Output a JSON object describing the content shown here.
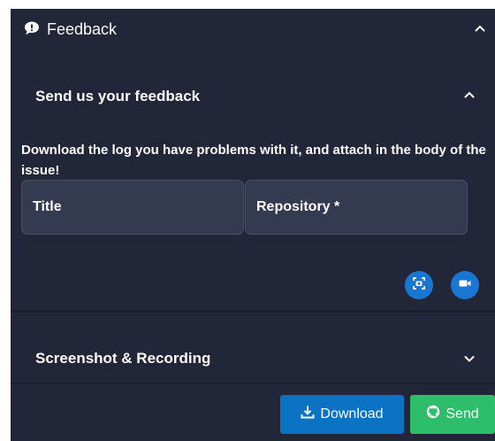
{
  "header": {
    "title": "Feedback",
    "icon": "comment-icon"
  },
  "feedback_section": {
    "title": "Send us your feedback",
    "description": "Download the log you have problems with it, and attach in the body of the issue!",
    "fields": [
      {
        "label": "Title"
      },
      {
        "label": "Repository *"
      }
    ],
    "actions": [
      "screenshot-icon",
      "video-camera-icon"
    ]
  },
  "recording_section": {
    "title": "Screenshot & Recording"
  },
  "footer": {
    "download_label": "Download",
    "send_label": "Send"
  },
  "colors": {
    "panel_bg": "#212639",
    "field_bg": "#343a50",
    "accent_blue": "#1976d2",
    "download_bg": "#0c73c4",
    "send_bg": "#2ebd6b"
  }
}
